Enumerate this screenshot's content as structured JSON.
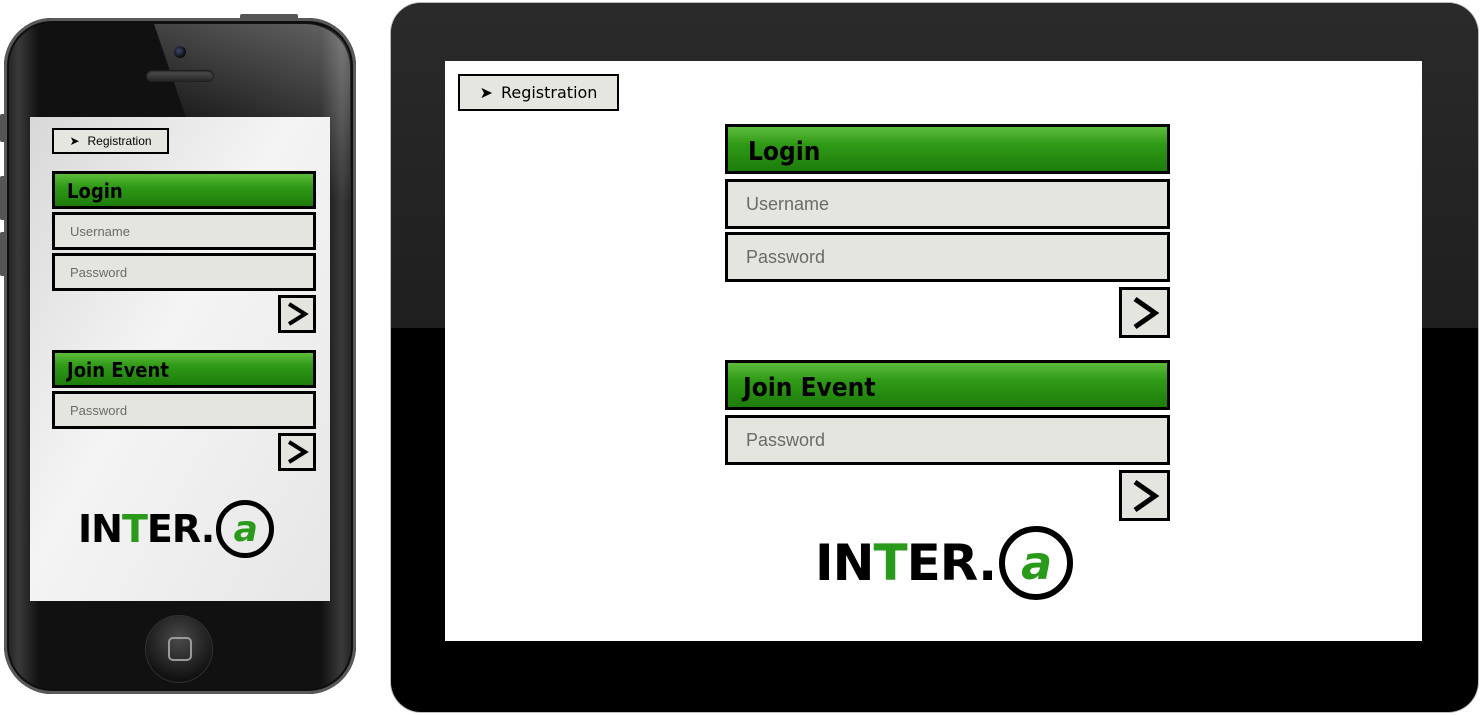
{
  "registration_label": "Registration",
  "registration_arrow": "➤",
  "login": {
    "title": "Login",
    "username_placeholder": "Username",
    "password_placeholder": "Password",
    "submit_icon": "chevron-right-icon"
  },
  "join_event": {
    "title": "Join Event",
    "password_placeholder": "Password",
    "submit_icon": "chevron-right-icon"
  },
  "logo": {
    "part1": "IN",
    "part2": "T",
    "part3": "ER.",
    "at_letter": "a"
  },
  "colors": {
    "accent_green": "#2a9a1a",
    "field_bg": "#e5e5df"
  }
}
